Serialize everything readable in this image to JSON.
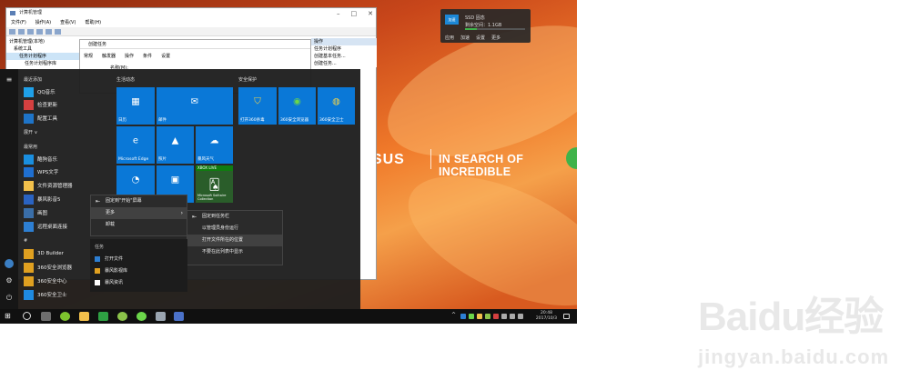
{
  "window": {
    "title": "计算机管理",
    "menu": [
      "文件(F)",
      "操作(A)",
      "查看(V)",
      "帮助(H)"
    ],
    "tree": [
      "计算机管理(本地)",
      "系统工具",
      "任务计划程序",
      "任务计划程序库"
    ],
    "subwindow": {
      "title": "创建任务",
      "tabs": [
        "常规",
        "触发器",
        "操作",
        "条件",
        "设置"
      ],
      "field_label": "名称(M):"
    },
    "actions": {
      "header": "操作",
      "items": [
        "任务计划程序",
        "创建基本任务...",
        "创建任务..."
      ]
    }
  },
  "widget": {
    "label1": "SSD 固态",
    "label2": "剩余空间：1.1GB",
    "badge": "加速",
    "footer": [
      "应用",
      "加速",
      "设置",
      "更多"
    ]
  },
  "wallpaper": {
    "brand": "/ISUS",
    "slogan": "IN SEARCH OF INCREDIBLE"
  },
  "start": {
    "recent_header": "最近添加",
    "recent": [
      "QQ音乐",
      "检查更新",
      "配置工具"
    ],
    "expand": "展开 ∨",
    "frequent_header": "最常用",
    "frequent": [
      "酷狗音乐",
      "WPS文字",
      "文件资源管理器",
      "暴风影音5",
      "画图",
      "远程桌面连接"
    ],
    "letter": "#",
    "letter_apps": [
      "3D Builder",
      "360安全浏览器",
      "360安全中心",
      "360安全卫士"
    ],
    "groups": [
      "生活动态",
      "安全保护"
    ],
    "tiles": {
      "calendar": "日历",
      "mail": "邮件",
      "edge": "Microsoft Edge",
      "photos": "照片",
      "weather": "暴风天气",
      "store_a": "",
      "store_b": "",
      "xbox": "XBOX LIVE",
      "solitaire": "Microsoft Solitaire Collection",
      "sec1": "打开360杀毒",
      "sec2": "360安全浏览器",
      "sec3": "360安全卫士"
    }
  },
  "context_main": [
    "固定到\"开始\"屏幕",
    "更多",
    "卸载"
  ],
  "context_sub": [
    "固定到任务栏",
    "以管理员身份运行",
    "打开文件所在的位置",
    "不要在此列表中显示"
  ],
  "jumplist": {
    "header": "任务",
    "items": [
      "打开文件",
      "暴风影视库",
      "暴风资讯"
    ]
  },
  "taskbar": {
    "time": "20:48",
    "date": "2017/10/3"
  },
  "watermark": {
    "logo": "Baidu经验",
    "url": "jingyan.baidu.com"
  },
  "colors": {
    "tile_blue": "#0a78d7",
    "start_bg": "#1e1e1e",
    "taskbar": "#101010"
  }
}
